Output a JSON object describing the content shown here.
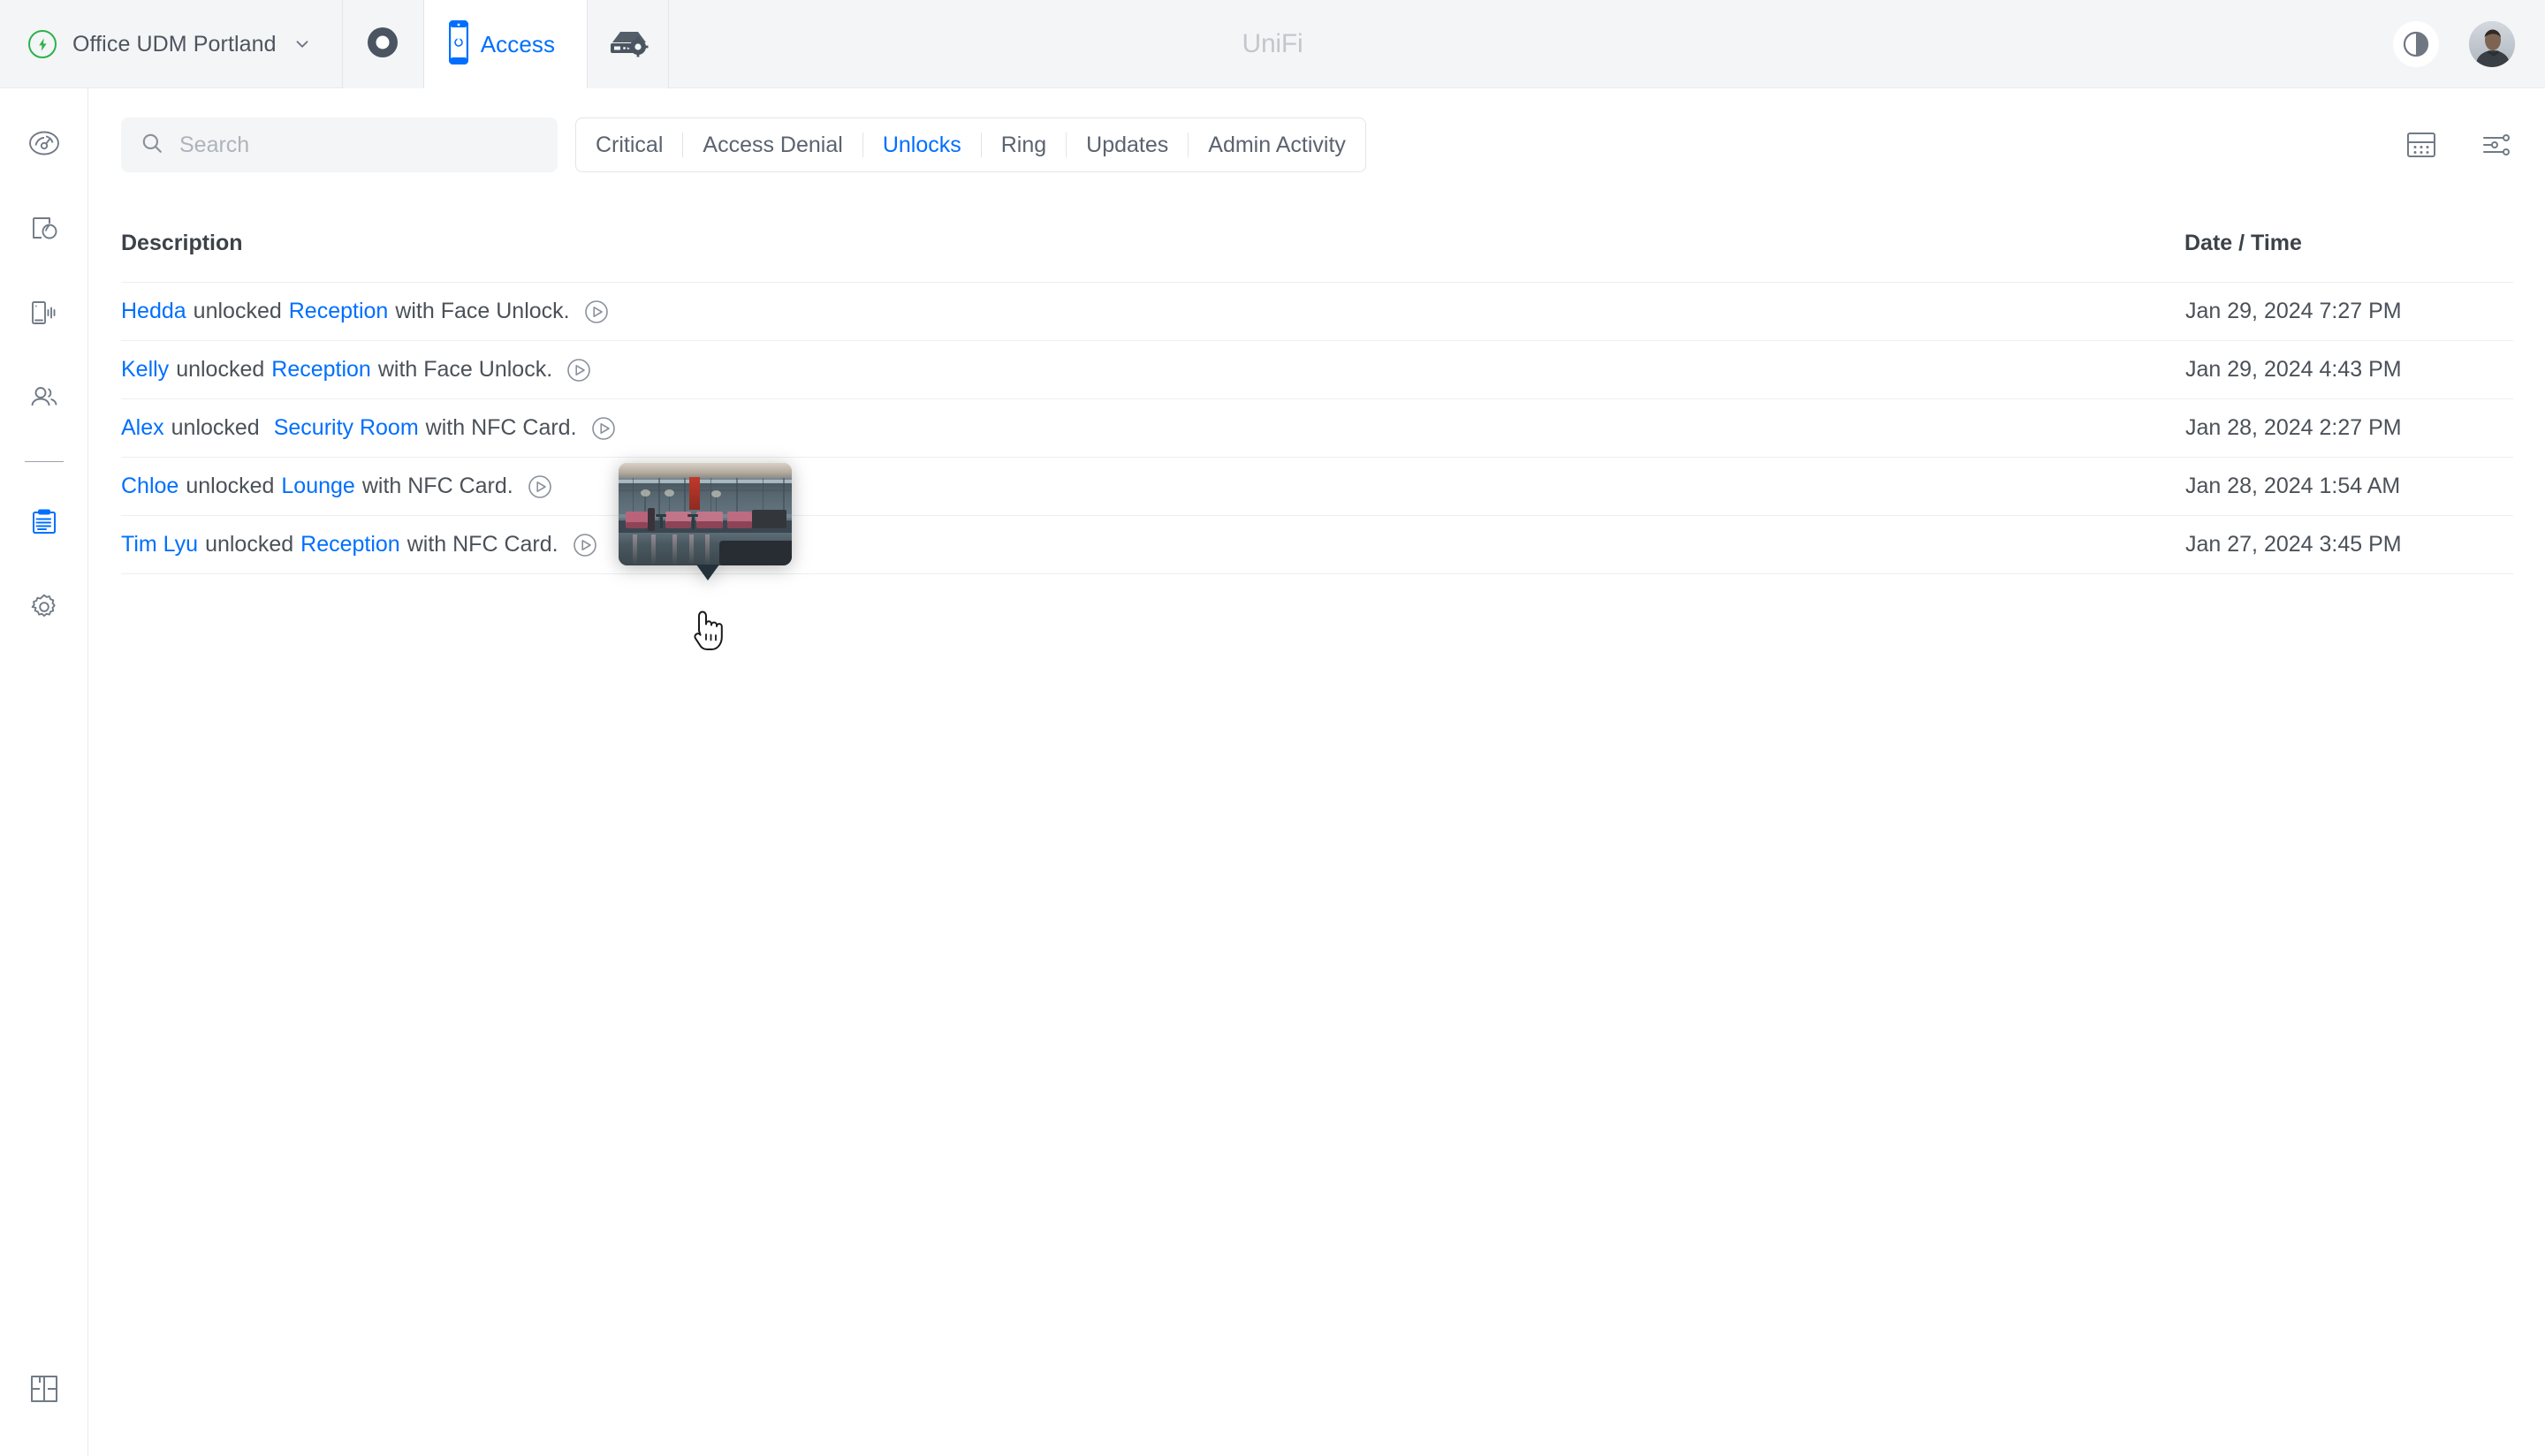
{
  "header": {
    "site_name": "Office UDM Portland",
    "site_icon": "power-bolt-icon",
    "chevron_icon": "chevron-down-icon",
    "brand": "UniFi",
    "apps": [
      {
        "name": "protect",
        "icon": "protect-camera-icon",
        "label": ""
      },
      {
        "name": "access",
        "icon": "access-reader-icon",
        "label": "Access"
      },
      {
        "name": "network",
        "icon": "network-device-icon",
        "label": ""
      }
    ],
    "theme_toggle_icon": "contrast-half-circle-icon",
    "avatar_icon": "user-avatar"
  },
  "sidebar": {
    "items": [
      {
        "name": "dashboard",
        "icon": "dashboard-gauge-icon",
        "active": false
      },
      {
        "name": "doors",
        "icon": "door-lock-icon",
        "active": false
      },
      {
        "name": "readers",
        "icon": "card-reader-signal-icon",
        "active": false
      },
      {
        "name": "users",
        "icon": "users-icon",
        "active": false
      },
      {
        "name": "logs",
        "icon": "clipboard-log-icon",
        "active": true
      },
      {
        "name": "settings",
        "icon": "gear-icon",
        "active": false
      }
    ],
    "bottom_item": {
      "name": "floorplan",
      "icon": "floorplan-icon"
    }
  },
  "toolbar": {
    "search": {
      "placeholder": "Search",
      "value": "",
      "icon": "search-icon"
    },
    "tabs": [
      {
        "label": "Critical",
        "active": false
      },
      {
        "label": "Access Denial",
        "active": false
      },
      {
        "label": "Unlocks",
        "active": true
      },
      {
        "label": "Ring",
        "active": false
      },
      {
        "label": "Updates",
        "active": false
      },
      {
        "label": "Admin Activity",
        "active": false
      }
    ],
    "view_toggle_icon": "table-view-icon",
    "filter_icon": "filter-sliders-icon"
  },
  "table": {
    "columns": {
      "description": "Description",
      "datetime": "Date / Time"
    },
    "rows": [
      {
        "actor": "Hedda",
        "verb": "unlocked",
        "door": "Reception",
        "method": "with Face Unlock.",
        "has_play": true,
        "datetime": "Jan 29, 2024 7:27 PM"
      },
      {
        "actor": "Kelly",
        "verb": "unlocked",
        "door": "Reception",
        "method": "with Face Unlock.",
        "has_play": true,
        "datetime": "Jan 29, 2024 4:43 PM"
      },
      {
        "actor": "Alex",
        "verb": "unlocked",
        "door": "Security Room",
        "method": "with NFC Card.",
        "has_play": true,
        "datetime": "Jan 28, 2024 2:27 PM"
      },
      {
        "actor": "Chloe",
        "verb": "unlocked",
        "door": "Lounge",
        "method": "with NFC Card.",
        "has_play": true,
        "datetime": "Jan 28, 2024 1:54 AM"
      },
      {
        "actor": "Tim Lyu",
        "verb": "unlocked",
        "door": "Reception",
        "method": "with NFC Card.",
        "has_play": true,
        "datetime": "Jan 27, 2024 3:45 PM"
      }
    ]
  },
  "preview_tooltip": {
    "name": "camera-snapshot-preview",
    "description": "Lounge seating area camera snapshot"
  },
  "colors": {
    "accent": "#006fff",
    "active_green": "#2bb24c",
    "text": "#4b5159",
    "muted": "#aeb4bc",
    "chrome": "#f4f5f6",
    "border": "#e9eaec"
  }
}
